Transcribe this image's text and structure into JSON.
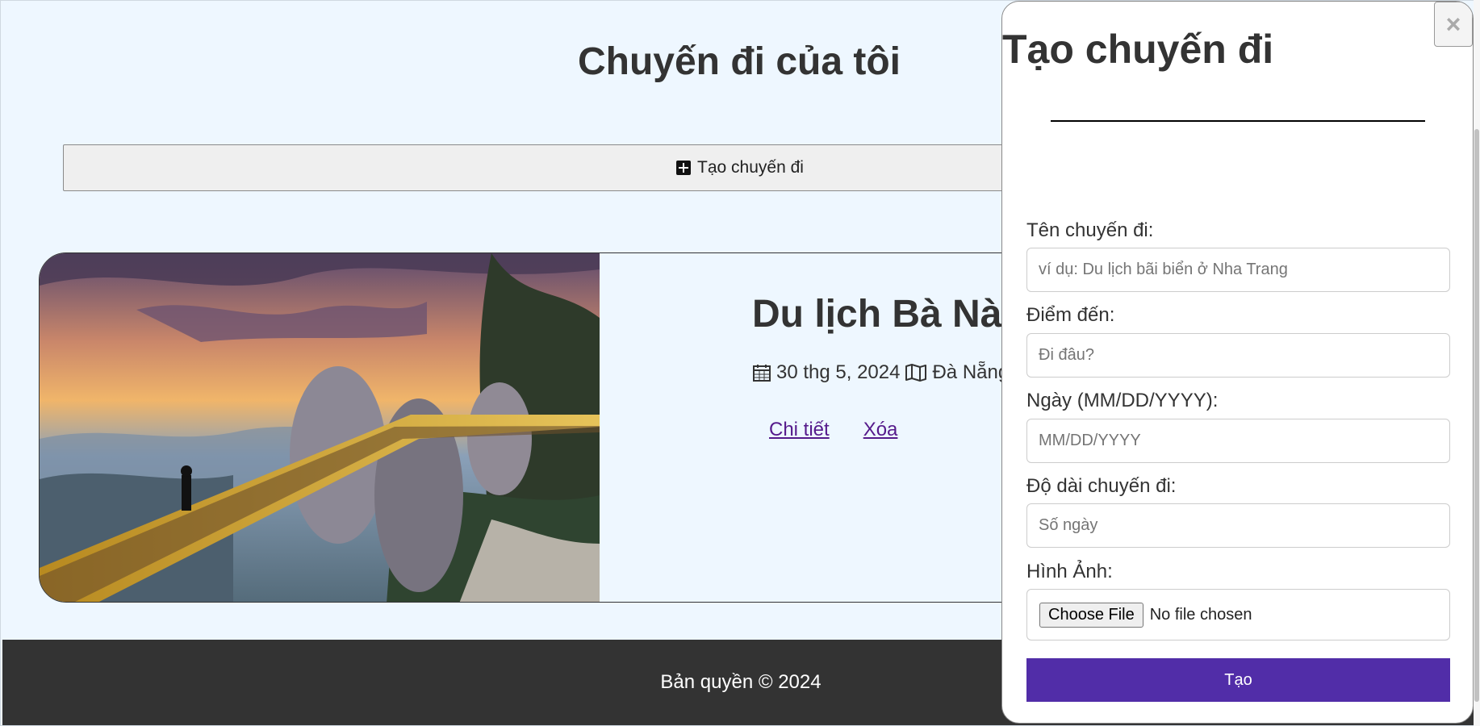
{
  "page": {
    "title": "Chuyến đi của tôi"
  },
  "toolbar": {
    "create_label": "Tạo chuyến đi",
    "create_icon": "plus-square-icon"
  },
  "trips": [
    {
      "title": "Du lịch Bà Nà Hills",
      "date": "30 thg 5, 2024",
      "destination": "Đà Nẵng",
      "date_icon": "calendar-icon",
      "destination_icon": "map-icon",
      "image": "golden-bridge-photo",
      "links": {
        "details": "Chi tiết",
        "delete": "Xóa"
      }
    }
  ],
  "footer": {
    "copyright": "Bản quyền © 2024"
  },
  "modal": {
    "title": "Tạo chuyến đi",
    "close_label": "×",
    "fields": {
      "name": {
        "label": "Tên chuyến đi:",
        "placeholder": "ví dụ: Du lịch bãi biển ở Nha Trang"
      },
      "destination": {
        "label": "Điểm đến:",
        "placeholder": "Đi đâu?"
      },
      "date": {
        "label": "Ngày (MM/DD/YYYY):",
        "placeholder": "MM/DD/YYYY"
      },
      "duration": {
        "label": "Độ dài chuyến đi:",
        "placeholder": "Số ngày"
      },
      "image": {
        "label": "Hình Ảnh:",
        "button": "Choose File",
        "status": "No file chosen"
      }
    },
    "submit_label": "Tạo"
  },
  "colors": {
    "page_bg": "#eef7ff",
    "footer_bg": "#333333",
    "submit_bg": "#512da8",
    "link": "#551a8b"
  }
}
